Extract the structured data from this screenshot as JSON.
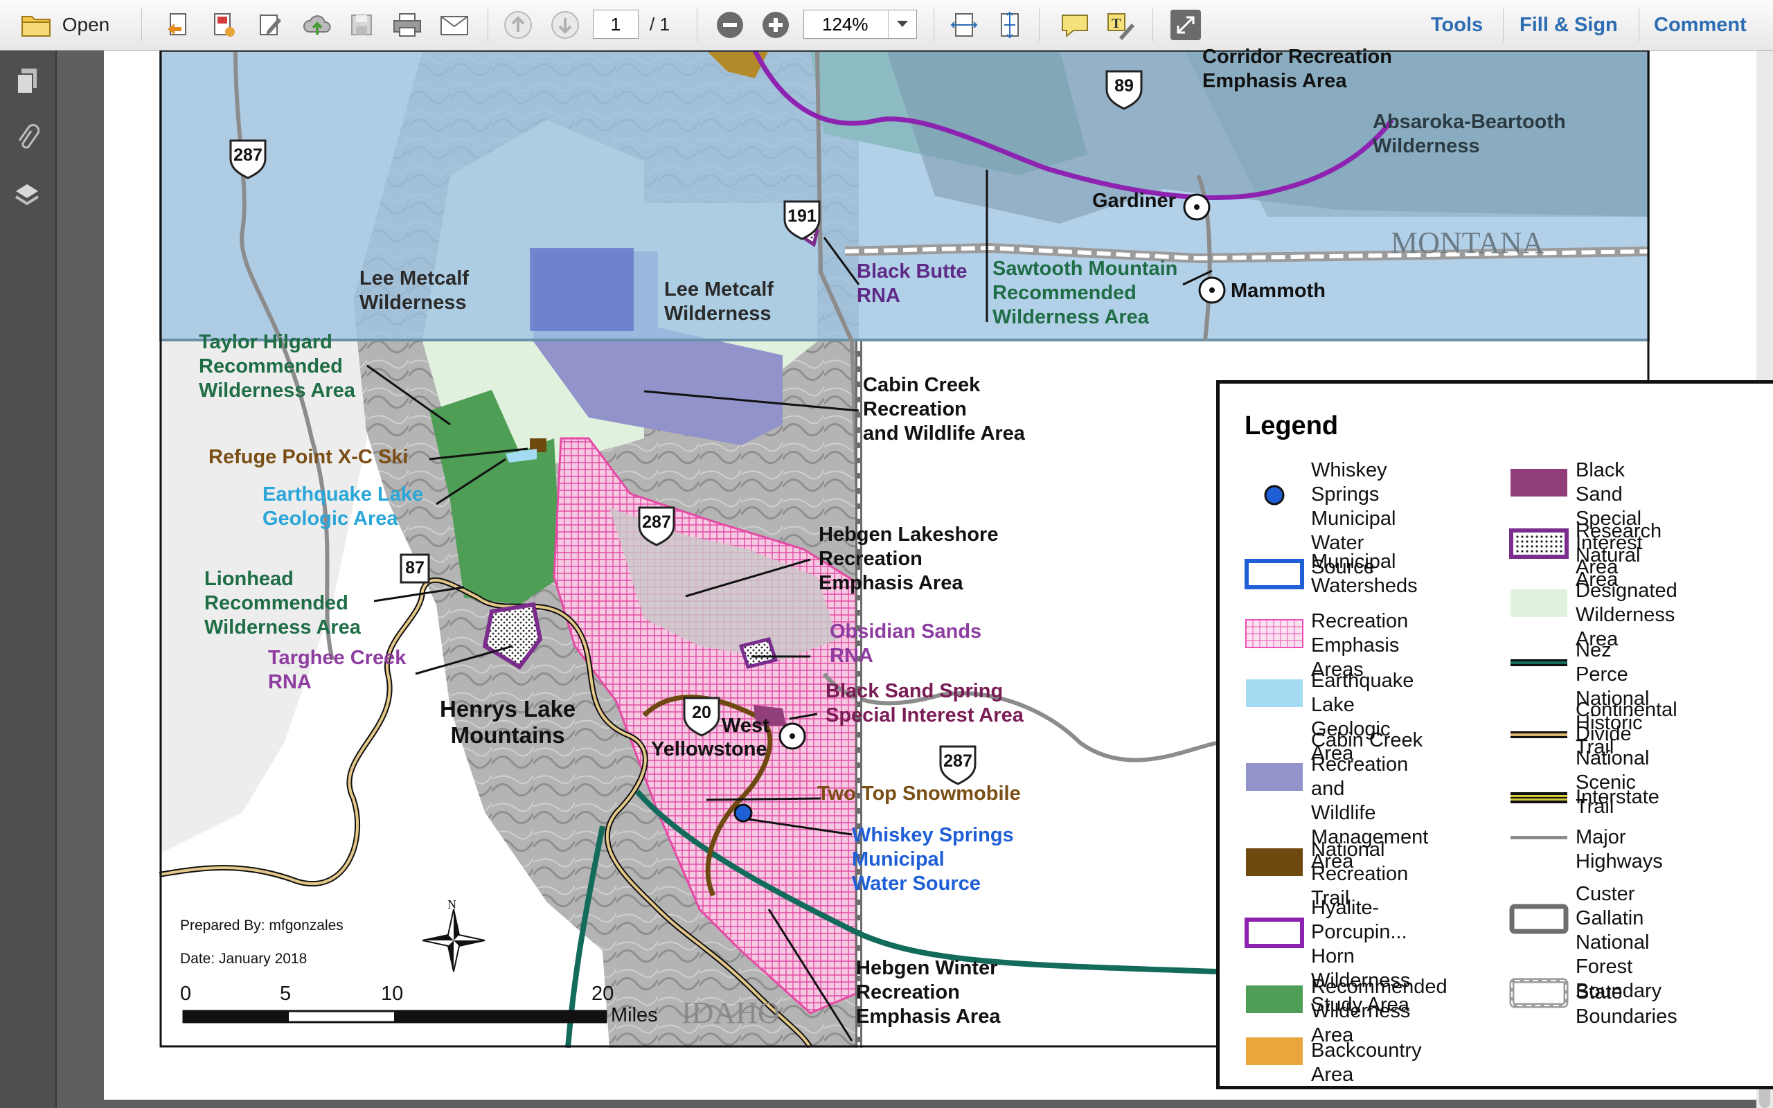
{
  "toolbar": {
    "open_label": "Open",
    "page_current": "1",
    "page_total": "/ 1",
    "zoom": "124%",
    "tools": "Tools",
    "fill_sign": "Fill & Sign",
    "comment": "Comment"
  },
  "map": {
    "labels": {
      "corridor": "Corridor Recreation",
      "corridor2": "Emphasis Area",
      "absaroka": "Absaroka-Beartooth",
      "absaroka2": "Wilderness",
      "gardiner": "Gardiner",
      "montana": "MONTANA",
      "mammoth": "Mammoth",
      "lee1a": "Lee Metcalf",
      "lee1b": "Wilderness",
      "lee2a": "Lee Metcalf",
      "lee2b": "Wilderness",
      "black_butte_a": "Black Butte",
      "black_butte_b": "RNA",
      "sawtooth_a": "Sawtooth Mountain",
      "sawtooth_b": "Recommended",
      "sawtooth_c": "Wilderness Area",
      "taylor_a": "Taylor Hilgard",
      "taylor_b": "Recommended",
      "taylor_c": "Wilderness Area",
      "cabin_a": "Cabin Creek",
      "cabin_b": "Recreation",
      "cabin_c": "and Wildlife Area",
      "refuge": "Refuge Point X-C Ski",
      "quake_a": "Earthquake Lake",
      "quake_b": "Geologic Area",
      "hebgen_a": "Hebgen  Lakeshore",
      "hebgen_b": "Recreation",
      "hebgen_c": "Emphasis Area",
      "lionhead_a": "Lionhead",
      "lionhead_b": "Recommended",
      "lionhead_c": "Wilderness Area",
      "obsidian_a": "Obsidian Sands",
      "obsidian_b": "RNA",
      "targhee_a": "Targhee Creek",
      "targhee_b": "RNA",
      "blacksand_a": "Black Sand Spring",
      "blacksand_b": "Special Interest Area",
      "henrys_a": "Henrys Lake",
      "henrys_b": "Mountains",
      "west_a": "West",
      "west_b": "Yellowstone",
      "twotop": "Two Top Snowmobile",
      "whiskey_a": "Whiskey Springs",
      "whiskey_b": "Municipal",
      "whiskey_c": "Water Source",
      "winter_a": "Hebgen Winter",
      "winter_b": "Recreation",
      "winter_c": "Emphasis Area",
      "idaho": "IDAHO",
      "prepared": "Prepared By:  mfgonzales",
      "date": "Date: January 2018",
      "north": "N",
      "miles": "Miles",
      "s0": "0",
      "s5": "5",
      "s10": "10",
      "s20": "20",
      "hw287a": "287",
      "hw89": "89",
      "hw191": "191",
      "hw287b": "287",
      "hw87": "87",
      "hw20": "20",
      "hw287c": "287"
    }
  },
  "legend": {
    "title": "Legend",
    "left": [
      {
        "label": [
          "Whiskey Springs",
          "Municipal Water",
          "Source"
        ],
        "icon": "water-source-dot",
        "color": "#1f5fd6"
      },
      {
        "label": [
          "Municipal",
          "Watersheds"
        ],
        "icon": "watershed-outline",
        "color": "#1f5fd6"
      },
      {
        "label": [
          "Recreation",
          "Emphasis Areas"
        ],
        "icon": "recreation-hatch",
        "color": "#ee4fb4"
      },
      {
        "label": [
          "Earthquake Lake",
          "Geologic Area"
        ],
        "icon": "geologic-fill",
        "color": "#a3dcf2"
      },
      {
        "label": [
          "Cabin Creek",
          "Recreation and",
          "Wildlife",
          "Management Area"
        ],
        "icon": "wildlife-fill",
        "color": "#9393cc"
      },
      {
        "label": [
          "National Recreation",
          "Trail"
        ],
        "icon": "trail-fill",
        "color": "#6e4910"
      },
      {
        "label": [
          "Hyalite-Porcupin...",
          "Horn Wilderness",
          "Study Area"
        ],
        "icon": "study-outline",
        "color": "#8e22b1"
      },
      {
        "label": [
          "Recommended",
          "Wilderness Area"
        ],
        "icon": "recommended-fill",
        "color": "#4e9e55"
      },
      {
        "label": [
          "Backcountry Area"
        ],
        "icon": "backcountry-fill",
        "color": "#eaa63d"
      }
    ],
    "right": [
      {
        "label": [
          "Black Sand Special",
          "Interest Area"
        ],
        "icon": "special-interest-fill",
        "color": "#913e7a"
      },
      {
        "label": [
          "Research Natural",
          "Area"
        ],
        "icon": "rna-pattern",
        "color": "#7a2d8c"
      },
      {
        "label": [
          "Designated",
          "Wilderness Area"
        ],
        "icon": "designated-fill",
        "color": "#e0f2de"
      },
      {
        "label": [
          "Nez Perce National",
          "Historic Trail"
        ],
        "icon": "nez-perce-line",
        "color": "#136b5b"
      },
      {
        "label": [
          "Continental Divide",
          "National Scenic",
          "Trail"
        ],
        "icon": "cdt-line",
        "color": "#d9b36a"
      },
      {
        "label": [
          "Interstate"
        ],
        "icon": "interstate-line",
        "color": "#d6cc3a"
      },
      {
        "label": [
          "Major Highways"
        ],
        "icon": "highway-line",
        "color": "#8c8c8c"
      },
      {
        "label": [
          "Custer Gallatin",
          "National Forest",
          "Boundary"
        ],
        "icon": "forest-boundary",
        "color": "#6d6d6d"
      },
      {
        "label": [
          "State Boundaries"
        ],
        "icon": "state-boundary",
        "color": "#9b9b9b"
      }
    ]
  }
}
